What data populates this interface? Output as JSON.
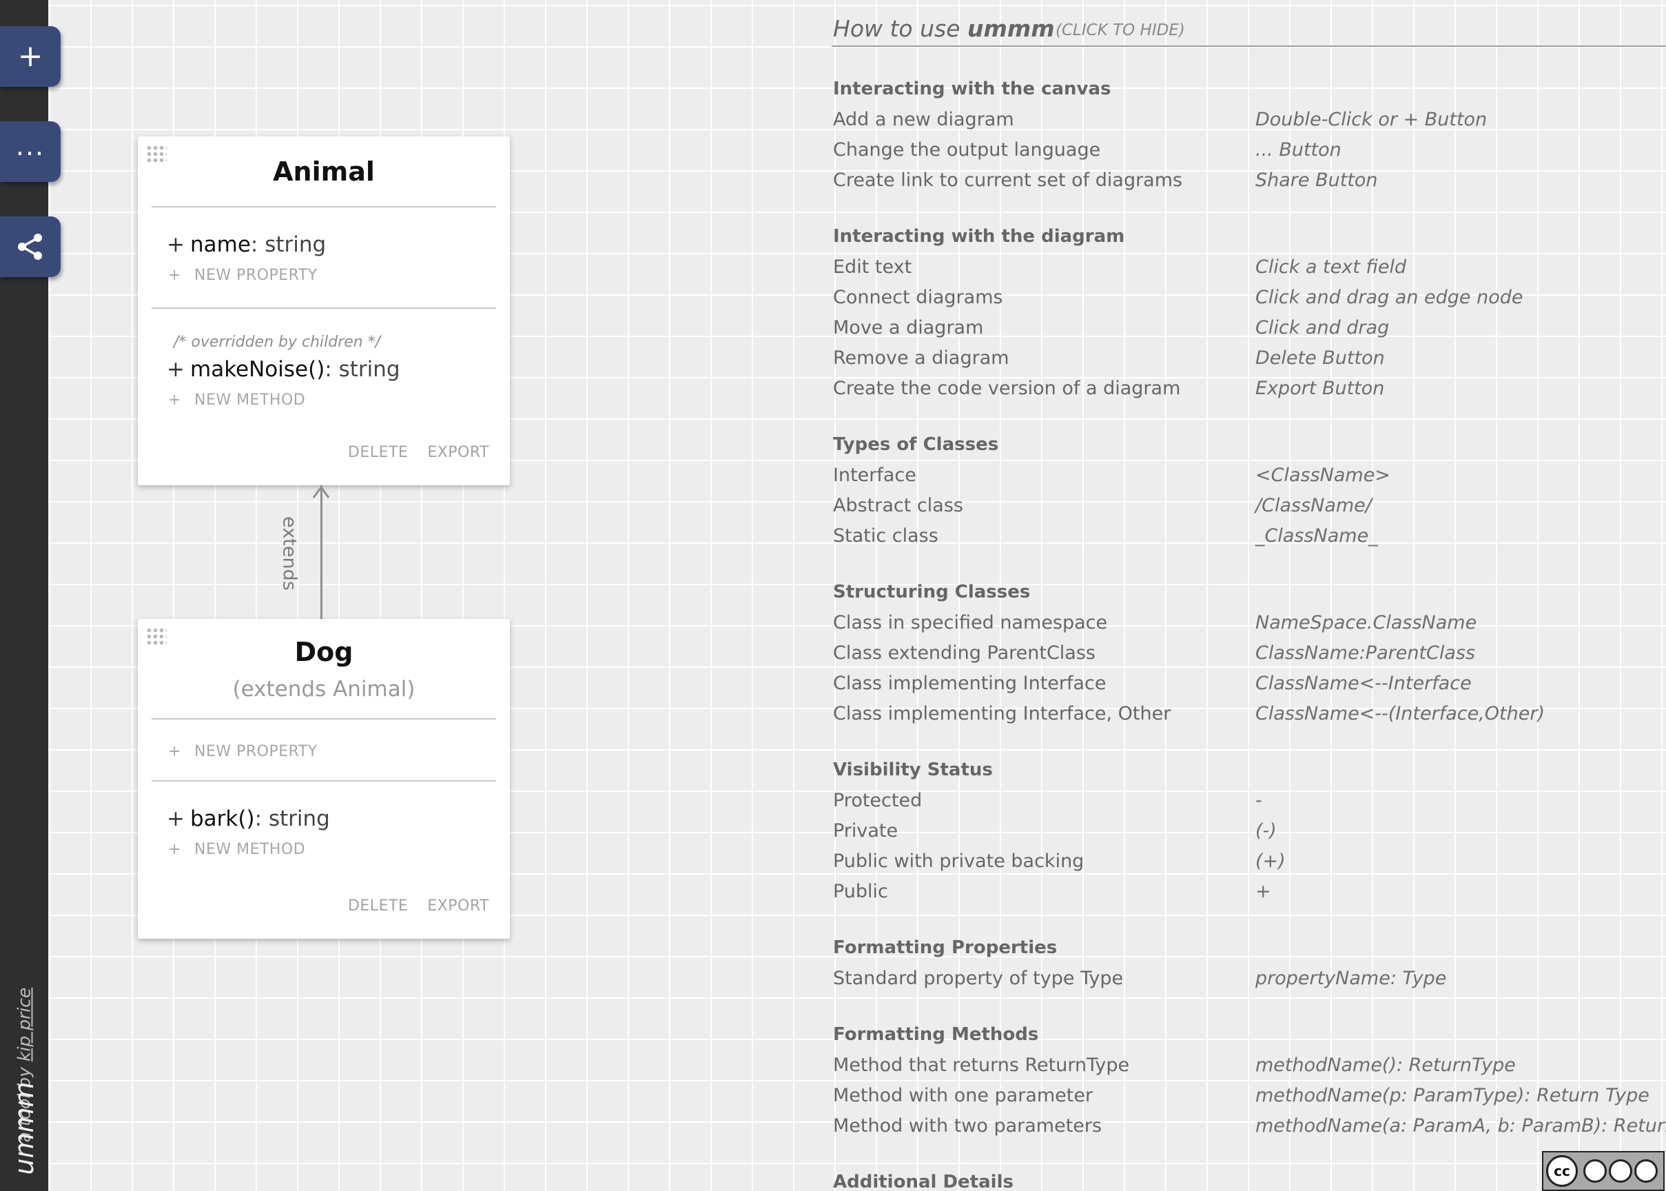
{
  "sidebar": {
    "add_glyph": "+",
    "more_glyph": "...",
    "caption_prefix": "a tool by ",
    "caption_author": "kip price",
    "brand": "ummm"
  },
  "classes": [
    {
      "name": "Animal",
      "extends_label": "",
      "properties": [
        {
          "visibility": "+",
          "name": "name",
          "type": ": string"
        }
      ],
      "new_property_label": "NEW PROPERTY",
      "methods_comment": "/* overridden by children */",
      "methods": [
        {
          "visibility": "+",
          "name": "makeNoise()",
          "type": ": string"
        }
      ],
      "new_method_label": "NEW METHOD",
      "delete_label": "DELETE",
      "export_label": "EXPORT"
    },
    {
      "name": "Dog",
      "extends_label": "(extends Animal)",
      "properties": [],
      "new_property_label": "NEW PROPERTY",
      "methods": [
        {
          "visibility": "+",
          "name": "bark()",
          "type": ": string"
        }
      ],
      "new_method_label": "NEW METHOD",
      "delete_label": "DELETE",
      "export_label": "EXPORT"
    }
  ],
  "edge": {
    "label": "extends"
  },
  "help": {
    "title_prefix": "How to use ",
    "title_brand": "ummm",
    "hide_label": "(CLICK TO HIDE)",
    "sections": [
      {
        "title": "Interacting with the canvas",
        "rows": [
          [
            "Add a new diagram",
            "Double-Click or + Button"
          ],
          [
            "Change the output language",
            "... Button"
          ],
          [
            "Create link to current set of diagrams",
            "Share Button"
          ]
        ]
      },
      {
        "title": "Interacting with the diagram",
        "rows": [
          [
            "Edit text",
            "Click a text field"
          ],
          [
            "Connect diagrams",
            "Click and drag an edge node"
          ],
          [
            "Move a diagram",
            "Click and drag"
          ],
          [
            "Remove a diagram",
            "Delete Button"
          ],
          [
            "Create the code version of a diagram",
            "Export Button"
          ]
        ]
      },
      {
        "title": "Types of Classes",
        "rows": [
          [
            "Interface",
            "<ClassName>"
          ],
          [
            "Abstract class",
            "/ClassName/"
          ],
          [
            "Static class",
            "_ClassName_"
          ]
        ]
      },
      {
        "title": "Structuring Classes",
        "rows": [
          [
            "Class in specified namespace",
            "NameSpace.ClassName"
          ],
          [
            "Class extending ParentClass",
            "ClassName:ParentClass"
          ],
          [
            "Class implementing Interface",
            "ClassName<--Interface"
          ],
          [
            "Class implementing Interface, Other",
            "ClassName<--(Interface,Other)"
          ]
        ]
      },
      {
        "title": "Visibility Status",
        "rows": [
          [
            "Protected",
            " -"
          ],
          [
            "Private",
            "(-)"
          ],
          [
            "Public with private backing",
            "(+)"
          ],
          [
            "Public",
            " +"
          ]
        ]
      },
      {
        "title": "Formatting Properties",
        "rows": [
          [
            "Standard property of type Type",
            "propertyName: Type"
          ]
        ]
      },
      {
        "title": "Formatting Methods",
        "rows": [
          [
            "Method that returns ReturnType",
            "methodName(): ReturnType"
          ],
          [
            "Method with one parameter",
            "methodName(p: ParamType): Return Type"
          ],
          [
            "Method with two parameters",
            "methodName(a: ParamA, b: ParamB): ReturnType"
          ]
        ]
      },
      {
        "title": "Additional Details",
        "rows": []
      }
    ]
  },
  "license": {
    "badge_text": "cc"
  },
  "colors": {
    "sidebar_bg": "#2f2f2f",
    "button_bg": "#3a4a78",
    "canvas_bg": "#ededed",
    "grid_line": "#ffffff"
  }
}
